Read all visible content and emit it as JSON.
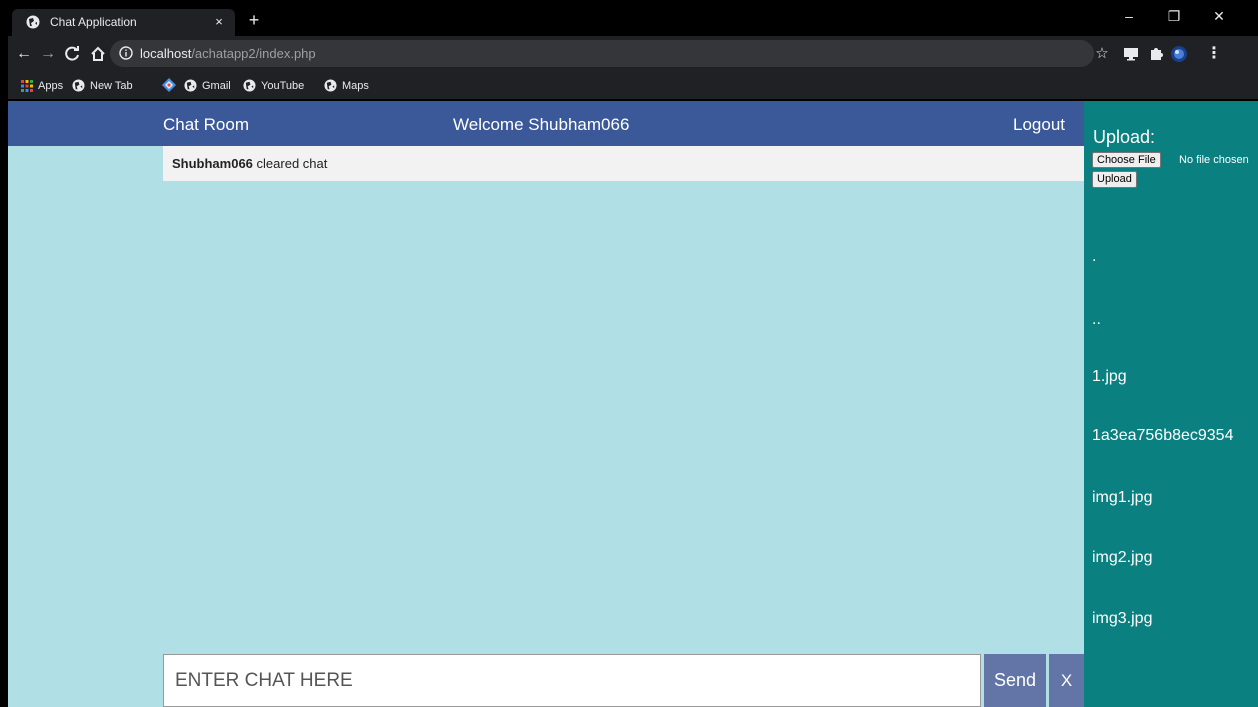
{
  "browser": {
    "tab_title": "Chat Application",
    "tab_close": "×",
    "new_tab": "+",
    "url_host": "localhost",
    "url_path": "/achatapp2/index.php",
    "bookmarks": {
      "apps": "Apps",
      "new_tab": "New Tab",
      "gmail": "Gmail",
      "youtube": "YouTube",
      "maps": "Maps"
    },
    "window": {
      "minimize": "–",
      "restore": "❐",
      "close": "✕"
    },
    "menu": "⋮"
  },
  "header": {
    "chat_room": "Chat Room",
    "welcome": "Welcome Shubham066",
    "logout": "Logout"
  },
  "chat": {
    "messages": [
      {
        "user": "Shubham066",
        "text": " cleared chat"
      }
    ],
    "input_placeholder": "ENTER CHAT HERE",
    "send_label": "Send",
    "clear_label": "X"
  },
  "sidebar": {
    "title": "Upload:",
    "choose_file_label": "Choose File",
    "file_status": "No file chosen",
    "upload_label": "Upload",
    "files": [
      ".",
      "..",
      "1.jpg",
      "1a3ea756b8ec9354",
      "img1.jpg",
      "img2.jpg",
      "img3.jpg"
    ]
  },
  "colors": {
    "header_bg": "#3b5998",
    "page_bg": "#b0dfe5",
    "sidebar_bg": "#0b8080",
    "button_bg": "#6275a6"
  }
}
